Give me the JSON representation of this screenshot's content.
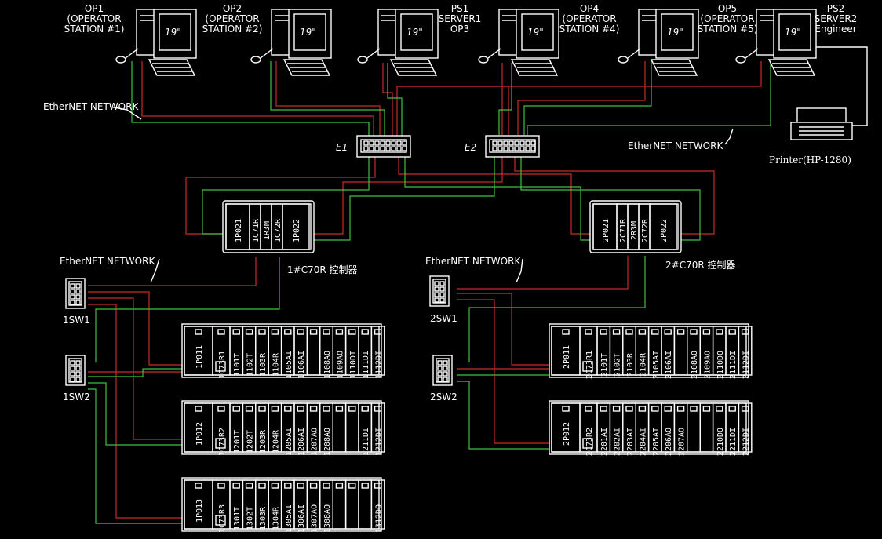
{
  "colors": {
    "background": "#000000",
    "line_a": "#c92a2a",
    "line_b": "#3fbf3f",
    "device": "#ffffff"
  },
  "stations": [
    {
      "title": [
        "OP1",
        "(OPERATOR",
        "STATION  #1)"
      ],
      "screen": "19\""
    },
    {
      "title": [
        "OP2",
        "(OPERATOR",
        "STATION  #2)"
      ],
      "screen": "19\""
    },
    {
      "title": [
        "PS1",
        "SERVER1",
        "OP3"
      ],
      "screen": "19\""
    },
    {
      "title": [
        "OP4",
        "(OPERATOR",
        "STATION  #4)"
      ],
      "screen": "19\""
    },
    {
      "title": [
        "OP5",
        "(OPERATOR",
        "STATION  #5)"
      ],
      "screen": "19\""
    },
    {
      "title": [
        "PS2",
        "SERVER2",
        "Engineer"
      ],
      "screen": "19\""
    }
  ],
  "network_labels": {
    "top_left": "EtherNET  NETWORK",
    "top_right": "EtherNET  NETWORK",
    "left": "EtherNET  NETWORK",
    "right": "EtherNET  NETWORK"
  },
  "hubs": {
    "e1": "E1",
    "e2": "E2"
  },
  "printer": {
    "label": "Printer(HP-1280)"
  },
  "controllers": [
    {
      "label": "1#C70R 控制器",
      "modules": [
        "1P021",
        "1C71R",
        "1R3M",
        "1C72R",
        "1P022"
      ]
    },
    {
      "label": "2#C70R 控制器",
      "modules": [
        "2P021",
        "2C71R",
        "2R3M",
        "2C72R",
        "2P022"
      ]
    }
  ],
  "switches": {
    "left": [
      "1SW1",
      "1SW2"
    ],
    "right": [
      "2SW1",
      "2SW2"
    ]
  },
  "racks": [
    {
      "modules": [
        "1P011",
        "1C73R1",
        "1101T",
        "1102T",
        "1103R",
        "1104R",
        "1105AI",
        "1106AI",
        "",
        "1108AO",
        "1109AO",
        "1110DI",
        "1111DI",
        "1112DI"
      ]
    },
    {
      "modules": [
        "1P012",
        "1C73R2",
        "1201T",
        "1202T",
        "1203R",
        "1204R",
        "1205AI",
        "1206AI",
        "1207AO",
        "1208AO",
        "",
        "",
        "1211DI",
        "1212DI"
      ]
    },
    {
      "modules": [
        "1P013",
        "1C73R3",
        "1301T",
        "1302T",
        "1303R",
        "1304R",
        "1305AI",
        "1306AI",
        "1307AO",
        "1308AO",
        "",
        "",
        "",
        "1312DO"
      ]
    },
    {
      "modules": [
        "2P011",
        "2C73R1",
        "2101T",
        "2102T",
        "2103R",
        "2104R",
        "2105AI",
        "2106AI",
        "",
        "2108AO",
        "2109AO",
        "2110DO",
        "2111DI",
        "2112DI"
      ]
    },
    {
      "modules": [
        "2P012",
        "2C73R2",
        "2201AI",
        "2202AI",
        "2203AI",
        "2204AI",
        "2205AI",
        "2206AO",
        "2207AO",
        "",
        "",
        "2210DO",
        "2211DI",
        "2212DI"
      ]
    }
  ]
}
